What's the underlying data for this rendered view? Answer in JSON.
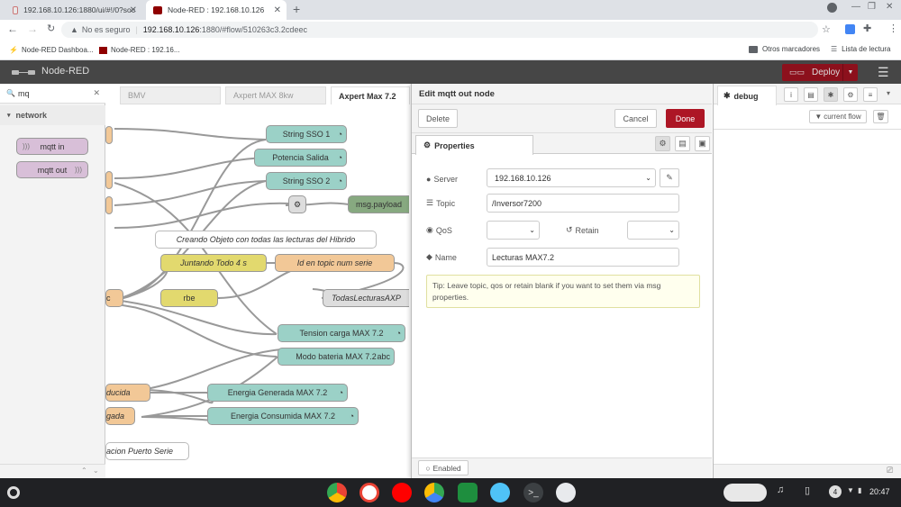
{
  "browser": {
    "tabs": [
      {
        "title": "192.168.10.126:1880/ui/#!/0?soc"
      },
      {
        "title": "Node-RED : 192.168.10.126"
      }
    ],
    "address_prefix": "No es seguro",
    "address_host": "192.168.10.126",
    "address_path": ":1880/#flow/510263c3.2cdeec",
    "bookmarks": [
      "Node-RED Dashboa...",
      "Node-RED : 192.16..."
    ],
    "other_bookmarks": "Otros marcadores",
    "reading_list": "Lista de lectura"
  },
  "header": {
    "title": "Node-RED",
    "deploy_label": "Deploy"
  },
  "palette": {
    "search_value": "mq",
    "category": "network",
    "nodes": [
      "mqtt in",
      "mqtt out"
    ]
  },
  "workspace": {
    "tabs": [
      "BMV",
      "Axpert MAX 8kw",
      "Axpert Max 7.2"
    ],
    "nodes": [
      "String SSO 1",
      "Potencia Salida",
      "String SSO 2",
      "msg.payload",
      "Creando Objeto con todas las lecturas del Hibrido",
      "Juntando Todo 4 s",
      "Id en topic num serie",
      "TodasLecturasAXP",
      "rbe",
      "Tension carga MAX 7.2",
      "Modo bateria MAX 7.2",
      "Energia Generada MAX 7.2",
      "Energia Consumida MAX 7.2",
      "ducida",
      "gada",
      "acion Puerto Serie",
      "c"
    ]
  },
  "editor": {
    "title": "Edit mqtt out node",
    "delete_label": "Delete",
    "cancel_label": "Cancel",
    "done_label": "Done",
    "properties_tab": "Properties",
    "server_label": "Server",
    "server_value": "192.168.10.126",
    "topic_label": "Topic",
    "topic_value": "/Inversor7200",
    "qos_label": "QoS",
    "qos_value": "",
    "retain_label": "Retain",
    "retain_value": "",
    "name_label": "Name",
    "name_value": "Lecturas MAX7.2",
    "tip": "Tip: Leave topic, qos or retain blank if you want to set them via msg properties.",
    "enabled_label": "Enabled"
  },
  "sidebar": {
    "tab_label": "debug",
    "filter_label": "current flow"
  },
  "taskbar": {
    "time": "20:47",
    "notif_count": "4"
  },
  "colors": {
    "header_bg": "#464646",
    "deploy_bg": "#8c101c",
    "done_bg": "#ad1625"
  }
}
